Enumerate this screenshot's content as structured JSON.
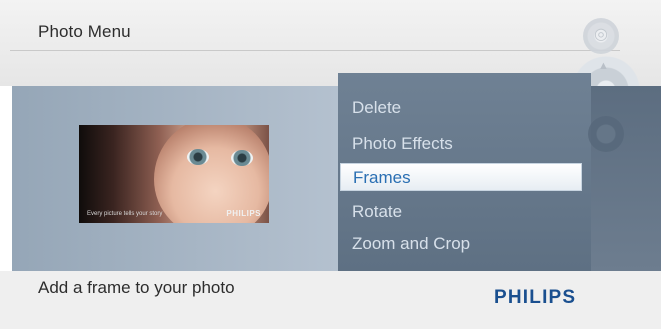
{
  "header": {
    "title": "Photo Menu"
  },
  "menu": {
    "items": [
      {
        "label": "Delete",
        "selected": false
      },
      {
        "label": "Photo Effects",
        "selected": false
      },
      {
        "label": "Frames",
        "selected": true
      },
      {
        "label": "Rotate",
        "selected": false
      },
      {
        "label": "Zoom and Crop",
        "selected": false
      }
    ]
  },
  "preview": {
    "caption": "Every picture tells your story",
    "brand": "PHILIPS"
  },
  "footer": {
    "help_text": "Add a frame to your photo",
    "brand": "PHILIPS"
  },
  "controls": [
    {
      "icon": "navigation-dial-icon"
    },
    {
      "icon": "dpad-control-icon"
    },
    {
      "icon": "menu-control-icon"
    }
  ],
  "colors": {
    "menu_panel": "#6f8194",
    "selected_background": "#ffffff",
    "selected_text": "#2a6fb3",
    "brand": "#1a4f8f"
  }
}
